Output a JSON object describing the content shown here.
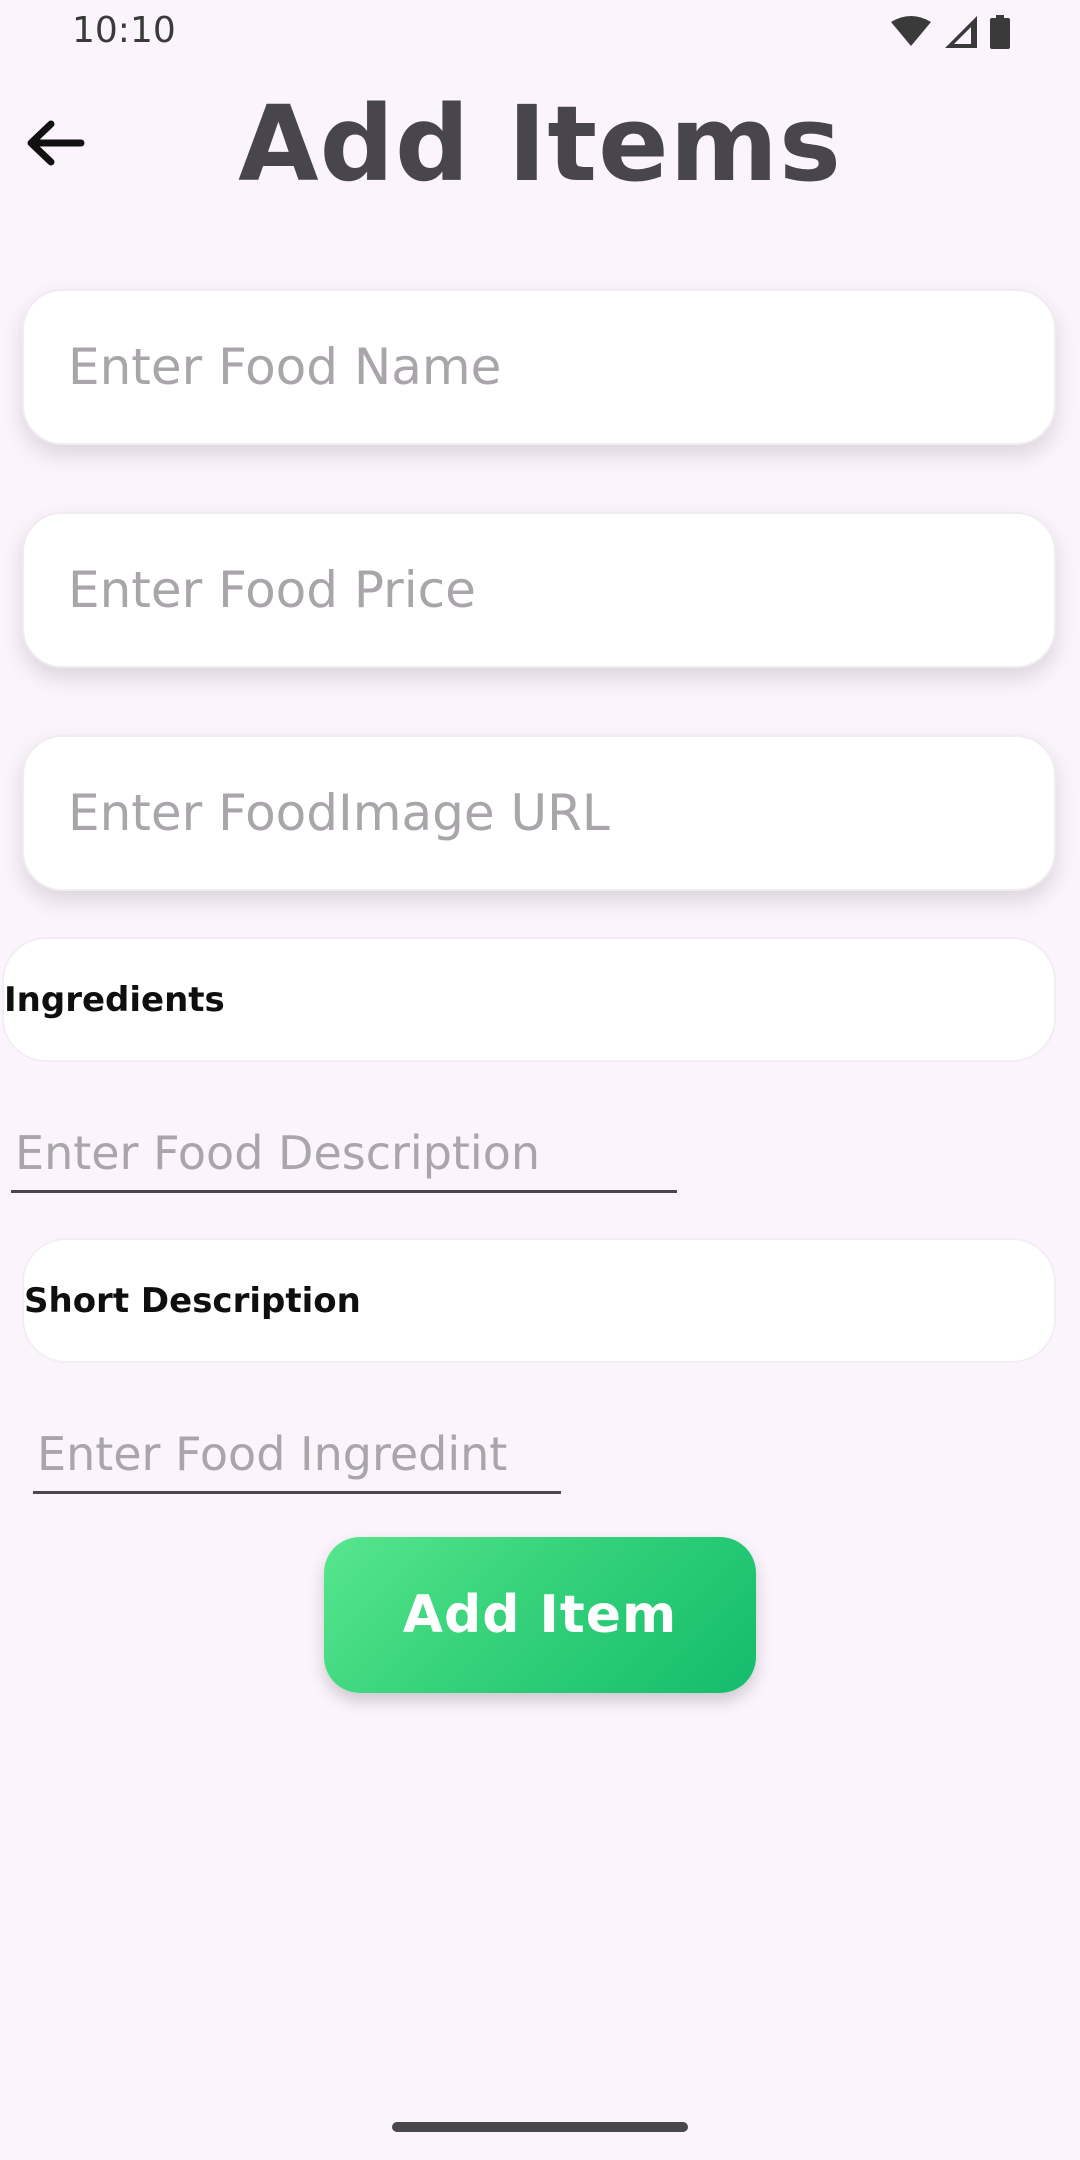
{
  "status_bar": {
    "time": "10:10",
    "icons": [
      "wifi-icon",
      "cellular-signal-icon",
      "battery-icon"
    ]
  },
  "header": {
    "back_icon": "arrow-left-icon",
    "title": "Add Items"
  },
  "form": {
    "food_name": {
      "placeholder": "Enter Food Name",
      "value": ""
    },
    "food_price": {
      "placeholder": "Enter Food Price",
      "value": ""
    },
    "food_image_url": {
      "placeholder": "Enter FoodImage URL",
      "value": ""
    },
    "ingredients_label": "Ingredients",
    "food_description": {
      "placeholder": "Enter Food Description",
      "value": ""
    },
    "short_description_label": "Short Description",
    "food_ingredient": {
      "placeholder": "Enter Food Ingredint",
      "value": ""
    },
    "submit_label": "Add Item"
  },
  "colors": {
    "background": "#fcf4fc",
    "title": "#48454e",
    "placeholder": "#a9a5ab",
    "button_gradient_start": "#58e68d",
    "button_gradient_end": "#13bc6c"
  }
}
